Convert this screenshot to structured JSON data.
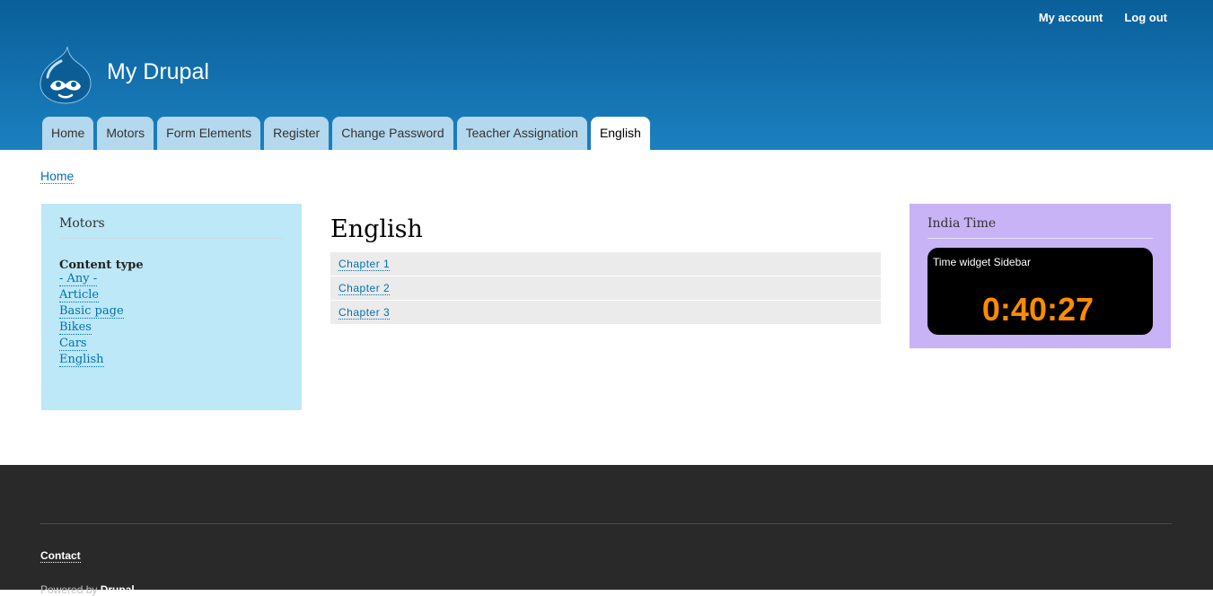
{
  "header": {
    "site_name": "My Drupal",
    "account_links": [
      {
        "label": "My account"
      },
      {
        "label": "Log out"
      }
    ],
    "tabs": [
      {
        "label": "Home"
      },
      {
        "label": "Motors"
      },
      {
        "label": "Form Elements"
      },
      {
        "label": "Register"
      },
      {
        "label": "Change Password"
      },
      {
        "label": "Teacher Assignation"
      },
      {
        "label": "English",
        "active": true
      }
    ]
  },
  "breadcrumb": {
    "label": "Home"
  },
  "sidebar_first": {
    "title": "Motors",
    "facet_title": "Content type",
    "items": [
      "- Any -",
      "Article",
      "Basic page",
      "Bikes",
      "Cars",
      "English"
    ]
  },
  "main": {
    "title": "English",
    "chapters": [
      "Chapter 1",
      "Chapter 2",
      "Chapter 3"
    ]
  },
  "sidebar_second": {
    "title": "India Time",
    "widget_label": "Time widget Sidebar",
    "time": "0:40:27"
  },
  "footer": {
    "contact_label": "Contact",
    "powered_text": "Powered by",
    "powered_link": "Drupal"
  },
  "colors": {
    "header_blue": "#1b80c0",
    "sidebar_first_bg": "#bce8f7",
    "sidebar_second_bg": "#c7b3f5",
    "time_color": "#ff8c00",
    "footer_bg": "#292929"
  }
}
